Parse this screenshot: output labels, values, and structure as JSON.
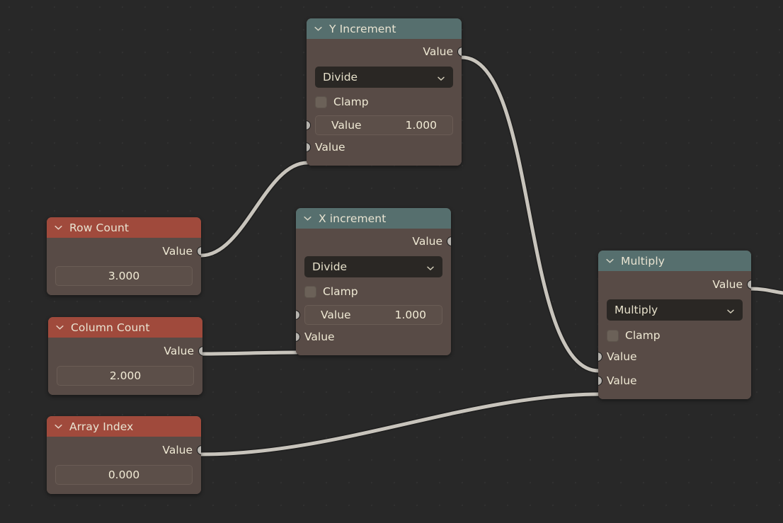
{
  "editor": {
    "name": "blender-shader-node-editor",
    "background_color": "#282828",
    "grid_dot_color": "#313131",
    "wire_color": "#c8c4bc",
    "socket_color": "#b6b3ae",
    "header_color_input": "#a04a3c",
    "header_color_converter": "#566f6e",
    "node_body_color": "#584b46"
  },
  "nodes": [
    {
      "id": "y-increment",
      "title": "Y Increment",
      "type": "math",
      "header_style": "teal",
      "outputs": [
        {
          "label": "Value"
        }
      ],
      "operation": "Divide",
      "clamp_label": "Clamp",
      "clamp_checked": false,
      "value_field": {
        "name": "Value",
        "value": "1.000"
      },
      "inputs": [
        {
          "label": "Value"
        }
      ]
    },
    {
      "id": "x-increment",
      "title": "X increment",
      "type": "math",
      "header_style": "teal",
      "outputs": [
        {
          "label": "Value"
        }
      ],
      "operation": "Divide",
      "clamp_label": "Clamp",
      "clamp_checked": false,
      "value_field": {
        "name": "Value",
        "value": "1.000"
      },
      "inputs": [
        {
          "label": "Value"
        }
      ]
    },
    {
      "id": "multiply",
      "title": "Multiply",
      "type": "math",
      "header_style": "teal",
      "outputs": [
        {
          "label": "Value"
        }
      ],
      "operation": "Multiply",
      "clamp_label": "Clamp",
      "clamp_checked": false,
      "inputs": [
        {
          "label": "Value"
        },
        {
          "label": "Value"
        }
      ]
    },
    {
      "id": "row-count",
      "title": "Row Count",
      "type": "value",
      "header_style": "red",
      "outputs": [
        {
          "label": "Value"
        }
      ],
      "value": "3.000"
    },
    {
      "id": "column-count",
      "title": "Column Count",
      "type": "value",
      "header_style": "red",
      "outputs": [
        {
          "label": "Value"
        }
      ],
      "value": "2.000"
    },
    {
      "id": "array-index",
      "title": "Array Index",
      "type": "value",
      "header_style": "red",
      "outputs": [
        {
          "label": "Value"
        }
      ],
      "value": "0.000"
    }
  ],
  "links": [
    {
      "from": "row-count.Value",
      "to": "y-increment.Value"
    },
    {
      "from": "column-count.Value",
      "to": "x-increment.Value"
    },
    {
      "from": "y-increment.Value",
      "to": "multiply.Value-1"
    },
    {
      "from": "array-index.Value",
      "to": "multiply.Value-2"
    },
    {
      "from": "multiply.Value",
      "to": "offscreen"
    }
  ],
  "icons": {
    "collapse": "chevron-down-icon",
    "dropdown": "chevron-down-icon"
  }
}
